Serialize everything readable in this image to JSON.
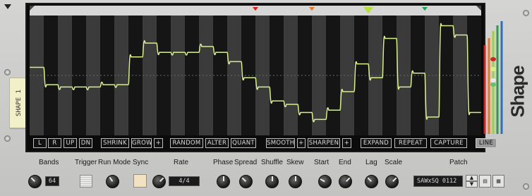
{
  "device": {
    "name_tape": "SHAPE 1",
    "logo": "Shape"
  },
  "display": {
    "markers": [
      {
        "color": "#d81e1e"
      },
      {
        "color": "#e07a28"
      },
      {
        "color": "#b4e03a"
      },
      {
        "color": "#1fa35a"
      }
    ],
    "waveform_color": "#d8f08a",
    "columns": 32,
    "waveform": [
      0.57,
      0.42,
      0.4,
      0.4,
      0.4,
      0.42,
      0.42,
      0.66,
      0.78,
      0.7,
      0.7,
      0.7,
      0.75,
      0.7,
      0.62,
      0.48,
      0.4,
      0.28,
      0.25,
      0.18,
      0.12,
      0.2,
      0.36,
      0.6,
      0.48,
      0.82,
      0.4,
      0.52,
      0.14,
      0.93,
      0.85,
      0.18
    ],
    "buttons": [
      {
        "label": "L",
        "active": false
      },
      {
        "label": "R",
        "active": false
      },
      {
        "label": "UP",
        "active": false
      },
      {
        "label": "DN",
        "active": false
      },
      {
        "label": "SHRINK",
        "active": false
      },
      {
        "label": "GROW",
        "active": false
      },
      {
        "label": "+",
        "active": false
      },
      {
        "label": "RANDOM",
        "active": false
      },
      {
        "label": "ALTER",
        "active": false
      },
      {
        "label": "QUANT",
        "active": false
      },
      {
        "label": "SMOOTH",
        "active": false
      },
      {
        "label": "+",
        "active": false
      },
      {
        "label": "SHARPEN",
        "active": false
      },
      {
        "label": "+",
        "active": false
      },
      {
        "label": "EXPAND",
        "active": false
      },
      {
        "label": "REPEAT",
        "active": false
      },
      {
        "label": "CAPTURE",
        "active": false
      },
      {
        "label": "LINE",
        "active": true
      }
    ],
    "meter_colors": [
      "#c62828",
      "#e07a28",
      "#9bd43a",
      "#2e9a4a",
      "#2a70c0"
    ]
  },
  "controls": {
    "bands": {
      "label": "Bands",
      "value": "64"
    },
    "trigger": {
      "label": "Trigger"
    },
    "run_mode": {
      "label": "Run Mode"
    },
    "sync": {
      "label": "Sync"
    },
    "rate": {
      "label": "Rate",
      "value": "4/4"
    },
    "phase": {
      "label": "Phase"
    },
    "spread": {
      "label": "Spread"
    },
    "shuffle": {
      "label": "Shuffle"
    },
    "skew": {
      "label": "Skew"
    },
    "start": {
      "label": "Start"
    },
    "end": {
      "label": "End"
    },
    "lag": {
      "label": "Lag"
    },
    "scale": {
      "label": "Scale"
    },
    "patch": {
      "label": "Patch",
      "value": "SAWxSQ 0112"
    }
  }
}
